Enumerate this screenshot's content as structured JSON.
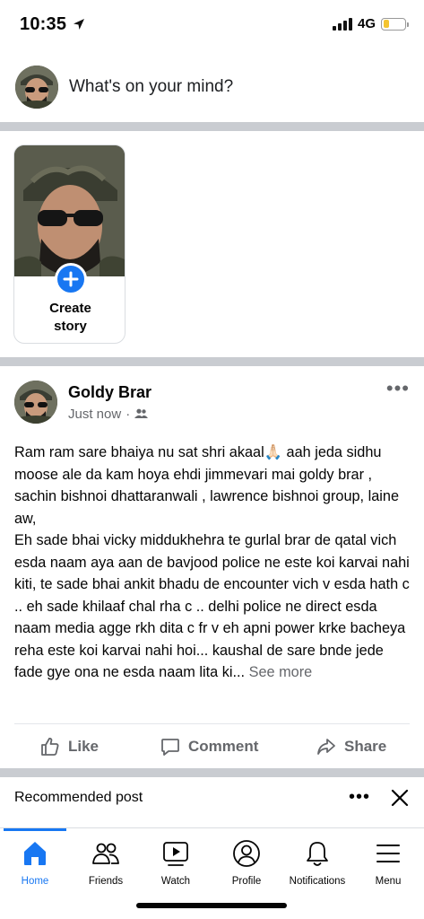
{
  "status_bar": {
    "time": "10:35",
    "network": "4G",
    "icons": [
      "location-arrow-icon",
      "signal-bars-icon",
      "battery-icon"
    ],
    "battery_color": "#f4c430"
  },
  "composer": {
    "placeholder": "What's on your mind?"
  },
  "stories": {
    "create_label_line1": "Create",
    "create_label_line2": "story",
    "accent": "#1877f2"
  },
  "post": {
    "author": "Goldy Brar",
    "time": "Just now",
    "separator": "·",
    "audience_icon": "friends-audience-icon",
    "paragraph1": "Ram ram sare bhaiya nu sat shri akaal🙏🏻 aah jeda sidhu moose ale da kam hoya ehdi jimmevari mai goldy brar , sachin bishnoi dhattaranwali , lawrence bishnoi group,  laine aw,",
    "paragraph2": "Eh sade bhai vicky middukhehra te gurlal brar de qatal vich esda naam aya aan de bavjood police ne este koi karvai nahi kiti, te sade bhai ankit bhadu de encounter vich v esda hath c .. eh sade khilaaf chal rha c .. delhi police ne direct esda naam media agge rkh dita c fr v eh apni power krke bacheya reha este koi karvai nahi hoi... kaushal de sare bnde jede fade gye ona ne esda naam lita ki...",
    "see_more": "See more",
    "actions": {
      "like": "Like",
      "comment": "Comment",
      "share": "Share"
    }
  },
  "recommended": {
    "title": "Recommended post"
  },
  "bottom_nav": {
    "items": [
      {
        "label": "Home",
        "icon": "home-icon",
        "active": true
      },
      {
        "label": "Friends",
        "icon": "friends-icon",
        "active": false
      },
      {
        "label": "Watch",
        "icon": "watch-icon",
        "active": false
      },
      {
        "label": "Profile",
        "icon": "profile-icon",
        "active": false
      },
      {
        "label": "Notifications",
        "icon": "bell-icon",
        "active": false
      },
      {
        "label": "Menu",
        "icon": "menu-icon",
        "active": false
      }
    ],
    "active_color": "#1877f2"
  }
}
